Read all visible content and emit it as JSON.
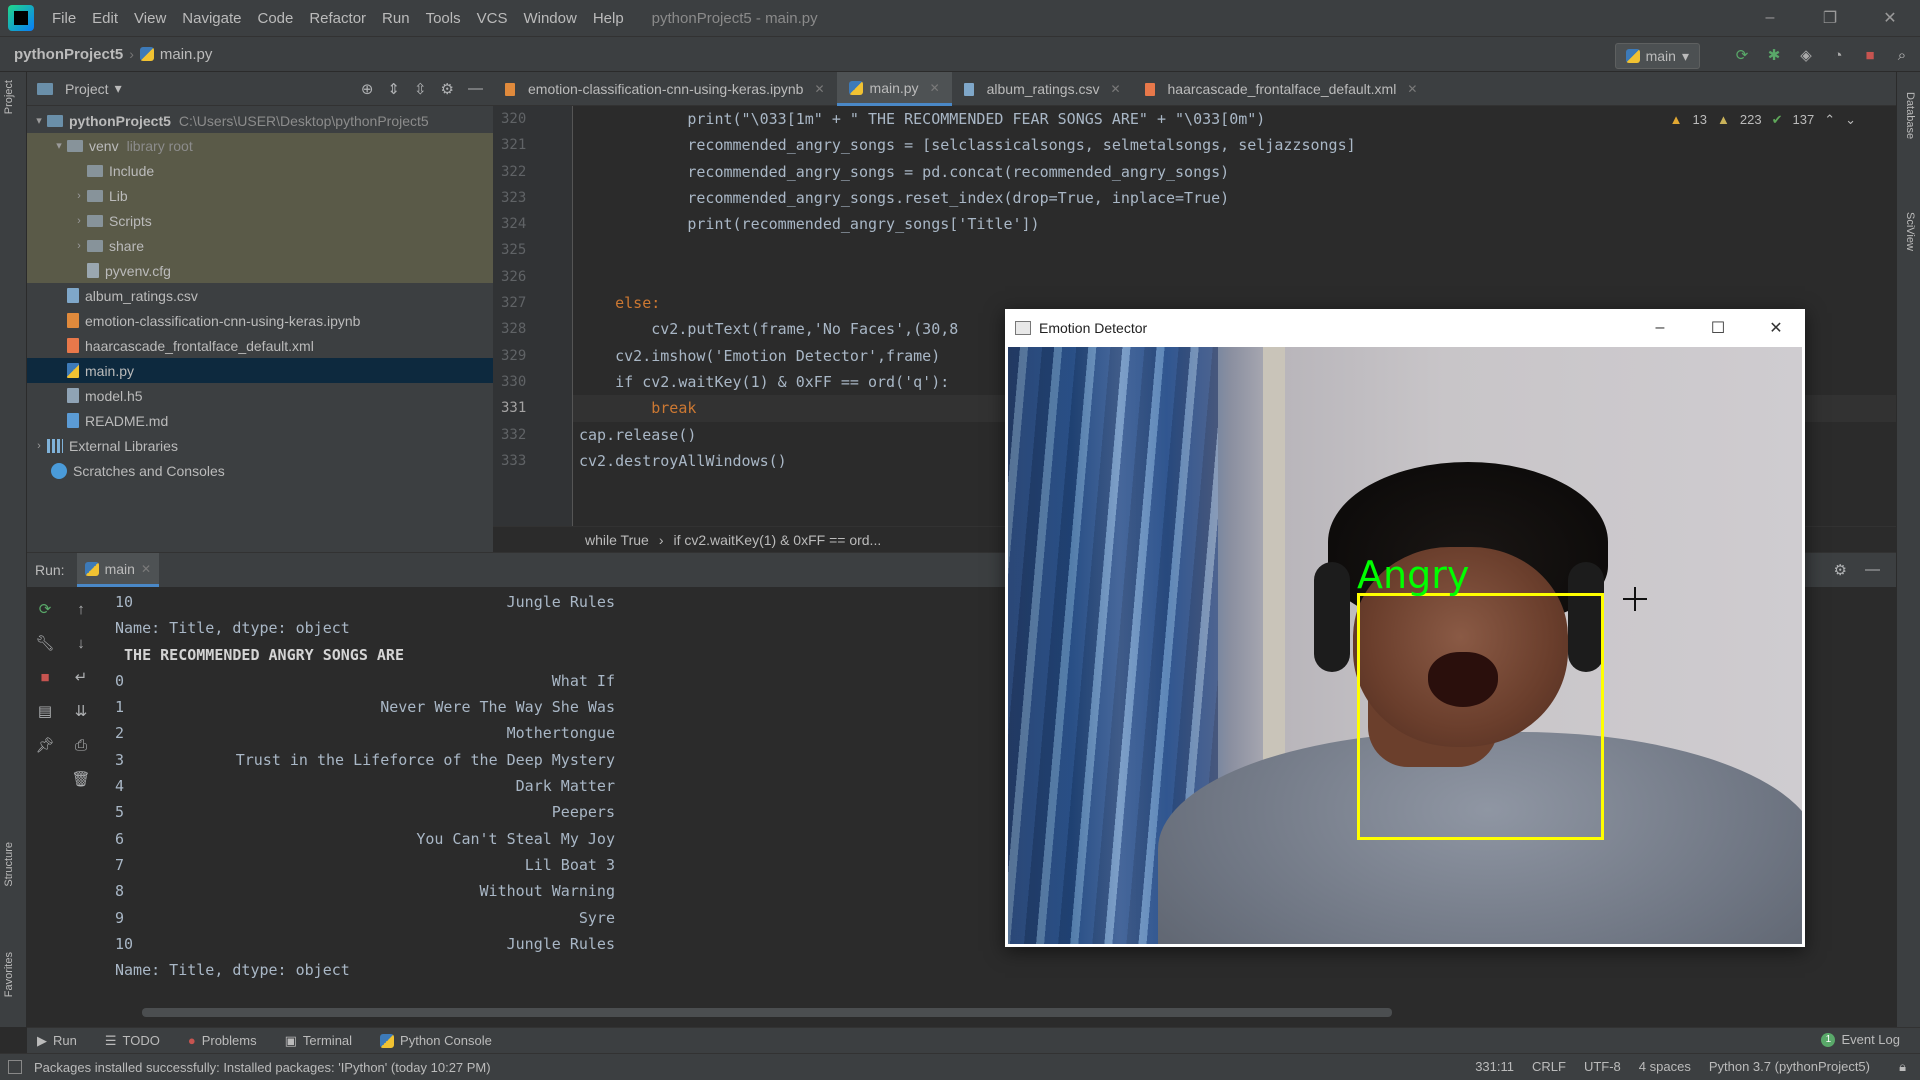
{
  "menubar": {
    "items": [
      "File",
      "Edit",
      "View",
      "Navigate",
      "Code",
      "Refactor",
      "Run",
      "Tools",
      "VCS",
      "Window",
      "Help"
    ],
    "window_title": "pythonProject5 - main.py",
    "controls": [
      "–",
      "❐",
      "✕"
    ]
  },
  "navbar": {
    "project": "pythonProject5",
    "file": "main.py",
    "run_config": "main"
  },
  "side_tabs": {
    "left_top": "Project",
    "left_structure": "Structure",
    "left_favorites": "Favorites",
    "right_database": "Database",
    "right_sciview": "SciView"
  },
  "project_panel": {
    "title": "Project",
    "tree": [
      {
        "label": "pythonProject5",
        "hint": "C:\\Users\\USER\\Desktop\\pythonProject5",
        "type": "folder",
        "level": 0,
        "expanded": true
      },
      {
        "label": "venv",
        "hint": "library root",
        "type": "folder",
        "level": 1,
        "expanded": true
      },
      {
        "label": "Include",
        "hint": "",
        "type": "folder",
        "level": 2,
        "expanded": false
      },
      {
        "label": "Lib",
        "hint": "",
        "type": "folder",
        "level": 2,
        "expanded": false
      },
      {
        "label": "Scripts",
        "hint": "",
        "type": "folder",
        "level": 2,
        "expanded": false
      },
      {
        "label": "share",
        "hint": "",
        "type": "folder",
        "level": 2,
        "expanded": false
      },
      {
        "label": "pyvenv.cfg",
        "hint": "",
        "type": "cfg",
        "level": 2
      },
      {
        "label": "album_ratings.csv",
        "hint": "",
        "type": "csv",
        "level": 1
      },
      {
        "label": "emotion-classification-cnn-using-keras.ipynb",
        "hint": "",
        "type": "ipynb",
        "level": 1
      },
      {
        "label": "haarcascade_frontalface_default.xml",
        "hint": "",
        "type": "xml",
        "level": 1
      },
      {
        "label": "main.py",
        "hint": "",
        "type": "py",
        "level": 1,
        "selected": true
      },
      {
        "label": "model.h5",
        "hint": "",
        "type": "h5",
        "level": 1
      },
      {
        "label": "README.md",
        "hint": "",
        "type": "md",
        "level": 1
      },
      {
        "label": "External Libraries",
        "hint": "",
        "type": "lib",
        "level": 0
      },
      {
        "label": "Scratches and Consoles",
        "hint": "",
        "type": "scratch",
        "level": 0
      }
    ]
  },
  "editor_tabs": [
    {
      "label": "emotion-classification-cnn-using-keras.ipynb",
      "active": false
    },
    {
      "label": "main.py",
      "active": true
    },
    {
      "label": "album_ratings.csv",
      "active": false
    },
    {
      "label": "haarcascade_frontalface_default.xml",
      "active": false
    }
  ],
  "inspections": {
    "warnings": "13",
    "weak_warnings": "223",
    "typos": "137"
  },
  "editor": {
    "lines": [
      {
        "n": "320",
        "code": "            print(\"\\033[1m\" + \" THE RECOMMENDED FEAR SONGS ARE\" + \"\\033[0m\")"
      },
      {
        "n": "321",
        "code": "            recommended_angry_songs = [selclassicalsongs, selmetalsongs, seljazzsongs]"
      },
      {
        "n": "322",
        "code": "            recommended_angry_songs = pd.concat(recommended_angry_songs)"
      },
      {
        "n": "323",
        "code": "            recommended_angry_songs.reset_index(drop=True, inplace=True)"
      },
      {
        "n": "324",
        "code": "            print(recommended_angry_songs['Title'])"
      },
      {
        "n": "325",
        "code": ""
      },
      {
        "n": "326",
        "code": ""
      },
      {
        "n": "327",
        "code": "    else:"
      },
      {
        "n": "328",
        "code": "        cv2.putText(frame,'No Faces',(30,8"
      },
      {
        "n": "329",
        "code": "    cv2.imshow('Emotion Detector',frame)"
      },
      {
        "n": "330",
        "code": "    if cv2.waitKey(1) & 0xFF == ord('q'):"
      },
      {
        "n": "331",
        "code": "        break"
      },
      {
        "n": "332",
        "code": "cap.release()"
      },
      {
        "n": "333",
        "code": "cv2.destroyAllWindows()"
      }
    ],
    "crumbs": [
      "while True",
      "if cv2.waitKey(1) & 0xFF == ord..."
    ]
  },
  "run_panel": {
    "label": "Run:",
    "tab": "main",
    "console": [
      {
        "idx": "10",
        "val": "Jungle Rules"
      },
      {
        "text": "Name: Title, dtype: object"
      },
      {
        "text": " THE RECOMMENDED ANGRY SONGS ARE",
        "bold": true
      },
      {
        "idx": "0",
        "val": "What If"
      },
      {
        "idx": "1",
        "val": "Never Were The Way She Was"
      },
      {
        "idx": "2",
        "val": "Mothertongue"
      },
      {
        "idx": "3",
        "val": "Trust in the Lifeforce of the Deep Mystery"
      },
      {
        "idx": "4",
        "val": "Dark Matter"
      },
      {
        "idx": "5",
        "val": "Peepers"
      },
      {
        "idx": "6",
        "val": "You Can't Steal My Joy"
      },
      {
        "idx": "7",
        "val": "Lil Boat 3"
      },
      {
        "idx": "8",
        "val": "Without Warning"
      },
      {
        "idx": "9",
        "val": "Syre"
      },
      {
        "idx": "10",
        "val": "Jungle Rules"
      },
      {
        "text": "Name: Title, dtype: object"
      }
    ]
  },
  "bottom_tabs": [
    "Run",
    "TODO",
    "Problems",
    "Terminal",
    "Python Console"
  ],
  "event_log": "Event Log",
  "statusbar": {
    "message": "Packages installed successfully: Installed packages: 'IPython' (today 10:27 PM)",
    "position": "331:11",
    "line_sep": "CRLF",
    "encoding": "UTF-8",
    "indent": "4 spaces",
    "interpreter": "Python 3.7 (pythonProject5)"
  },
  "cv_window": {
    "title": "Emotion Detector",
    "detection_label": "Angry"
  }
}
